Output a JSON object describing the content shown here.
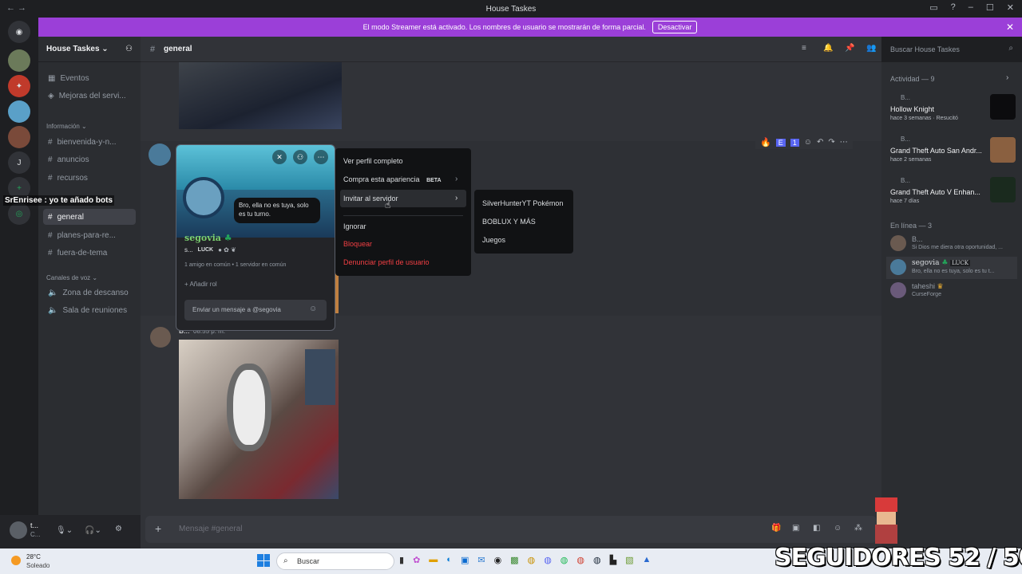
{
  "window": {
    "title": "House Taskes"
  },
  "banner": {
    "text": "El modo Streamer está activado. Los nombres de usuario se mostrarán de forma parcial.",
    "button": "Desactivar"
  },
  "server": {
    "name": "House Taskes"
  },
  "sidebar": {
    "top_items": [
      {
        "label": "Eventos"
      },
      {
        "label": "Mejoras del servi..."
      }
    ],
    "categories": [
      {
        "label": "Información",
        "channels": [
          "bienvenida-y-n...",
          "anuncios",
          "recursos",
          "general",
          "planes-para-re...",
          "fuera-de-tema"
        ]
      },
      {
        "label": "Canales de voz",
        "channels": [
          "Zona de descanso",
          "Sala de reuniones"
        ]
      }
    ],
    "overlay_text": "SrEnrisee : yo te añado bots"
  },
  "channel": {
    "name": "general",
    "search_placeholder": "Buscar House Taskes",
    "composer_placeholder": "Mensaje #general"
  },
  "reactions": {
    "e": "E",
    "one": "1"
  },
  "profile_popup": {
    "bubble": "Bro, ella no es tuya, solo es tu turno.",
    "name": "segovia",
    "tag_prefix": "s...",
    "luck": "LUCK",
    "mutuals": "1 amigo en común • 1 servidor en común",
    "add_role": "Añadir rol",
    "message_placeholder": "Enviar un mensaje a @segovia"
  },
  "context_menu": {
    "items": [
      "Ver perfil completo",
      "Compra esta apariencia",
      "Invitar al servidor",
      "Ignorar",
      "Bloquear",
      "Denunciar perfil de usuario"
    ],
    "beta": "BETA",
    "submenu": [
      "SilverHunterYT Pokémon",
      "BOBLUX Y MÁS",
      "Juegos"
    ]
  },
  "messages": [
    {
      "author": "B...",
      "time": "08:55 p. m."
    }
  ],
  "members": {
    "activity_header": "Actividad — 9",
    "activities": [
      {
        "user": "B...",
        "game": "Hollow Knight",
        "time": "hace 3 semanas",
        "status": "Resucitó"
      },
      {
        "user": "B...",
        "game": "Grand Theft Auto San Andr...",
        "time": "hace 2 semanas"
      },
      {
        "user": "B...",
        "game": "Grand Theft Auto V Enhan...",
        "time": "hace 7 días"
      }
    ],
    "online_header": "En línea — 3",
    "online": [
      {
        "name": "B...",
        "status": "Si Dios me diera otra oportunidad, ..."
      },
      {
        "name": "segovia",
        "luck": "LUCK",
        "status": "Bro, ella no es tuya, solo es tu t..."
      },
      {
        "name": "taheshi",
        "status": "CurseForge"
      }
    ]
  },
  "user_panel": {
    "name": "t...",
    "sub": "C..."
  },
  "taskbar": {
    "weather_temp": "28°C",
    "weather_text": "Soleado",
    "search": "Buscar"
  },
  "stream_overlay": {
    "followers": "SEGUIDORES 52 / 50"
  },
  "colors": {
    "accent": "#9b3fd8",
    "danger": "#f23f43",
    "online": "#23a55a"
  }
}
